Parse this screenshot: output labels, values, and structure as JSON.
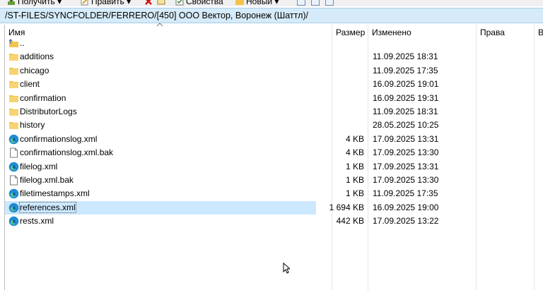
{
  "toolbar": {
    "items": [
      {
        "label": "Получить ▾",
        "icon": "download-icon"
      },
      {
        "label": "Править ▾",
        "icon": "edit-icon"
      },
      {
        "label": "Свойства",
        "icon": "properties-icon"
      },
      {
        "label": "Новый ▾",
        "icon": "new-folder-icon"
      }
    ]
  },
  "path": "/ST-FILES/SYNCFOLDER/FERRERO/[450] ООО Вектор, Воронеж (Шаттл)/",
  "columns": {
    "name": "Имя",
    "size": "Размер",
    "modified": "Изменено",
    "rights": "Права",
    "owner": "В"
  },
  "rows": [
    {
      "name": "..",
      "type": "parent",
      "size": "",
      "modified": ""
    },
    {
      "name": "additions",
      "type": "folder",
      "size": "",
      "modified": "11.09.2025 18:31"
    },
    {
      "name": "chicago",
      "type": "folder",
      "size": "",
      "modified": "11.09.2025 17:35"
    },
    {
      "name": "client",
      "type": "folder",
      "size": "",
      "modified": "16.09.2025 19:01"
    },
    {
      "name": "confirmation",
      "type": "folder",
      "size": "",
      "modified": "16.09.2025 19:31"
    },
    {
      "name": "DistributorLogs",
      "type": "folder",
      "size": "",
      "modified": "11.09.2025 18:31"
    },
    {
      "name": "history",
      "type": "folder",
      "size": "",
      "modified": "28.05.2025 10:25"
    },
    {
      "name": "confirmationslog.xml",
      "type": "xml",
      "size": "4 KB",
      "modified": "17.09.2025 13:31"
    },
    {
      "name": "confirmationslog.xml.bak",
      "type": "file",
      "size": "4 KB",
      "modified": "17.09.2025 13:30"
    },
    {
      "name": "filelog.xml",
      "type": "xml",
      "size": "1 KB",
      "modified": "17.09.2025 13:31"
    },
    {
      "name": "filelog.xml.bak",
      "type": "file",
      "size": "1 KB",
      "modified": "17.09.2025 13:30"
    },
    {
      "name": "filetimestamps.xml",
      "type": "xml",
      "size": "1 KB",
      "modified": "11.09.2025 17:35"
    },
    {
      "name": "references.xml",
      "type": "xml",
      "size": "1 694 KB",
      "modified": "16.09.2025 19:00",
      "selected": true
    },
    {
      "name": "rests.xml",
      "type": "xml",
      "size": "442 KB",
      "modified": "17.09.2025 13:22"
    }
  ]
}
